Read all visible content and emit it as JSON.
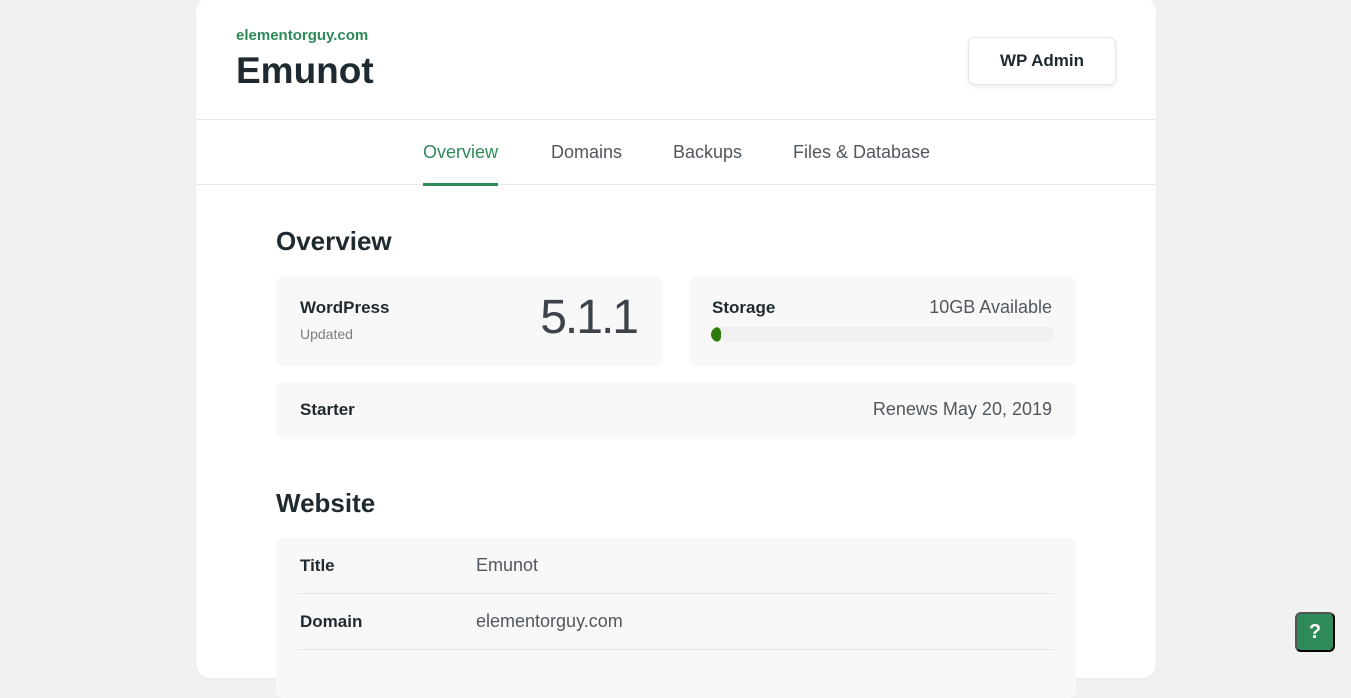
{
  "header": {
    "site_url": "elementorguy.com",
    "site_name": "Emunot",
    "wp_admin_label": "WP Admin"
  },
  "tabs": [
    {
      "label": "Overview",
      "active": true
    },
    {
      "label": "Domains",
      "active": false
    },
    {
      "label": "Backups",
      "active": false
    },
    {
      "label": "Files & Database",
      "active": false
    }
  ],
  "overview": {
    "title": "Overview",
    "wordpress": {
      "label": "WordPress",
      "status": "Updated",
      "version": "5.1.1"
    },
    "storage": {
      "label": "Storage",
      "available": "10GB Available",
      "used_fraction": 0.03
    },
    "plan": {
      "name": "Starter",
      "renewal": "Renews May 20, 2019"
    }
  },
  "website": {
    "title": "Website",
    "rows": [
      {
        "label": "Title",
        "value": "Emunot"
      },
      {
        "label": "Domain",
        "value": "elementorguy.com"
      }
    ]
  },
  "help": {
    "label": "?"
  },
  "colors": {
    "accent": "#2f8a5a",
    "storage_fill": "#2b7a0b"
  }
}
